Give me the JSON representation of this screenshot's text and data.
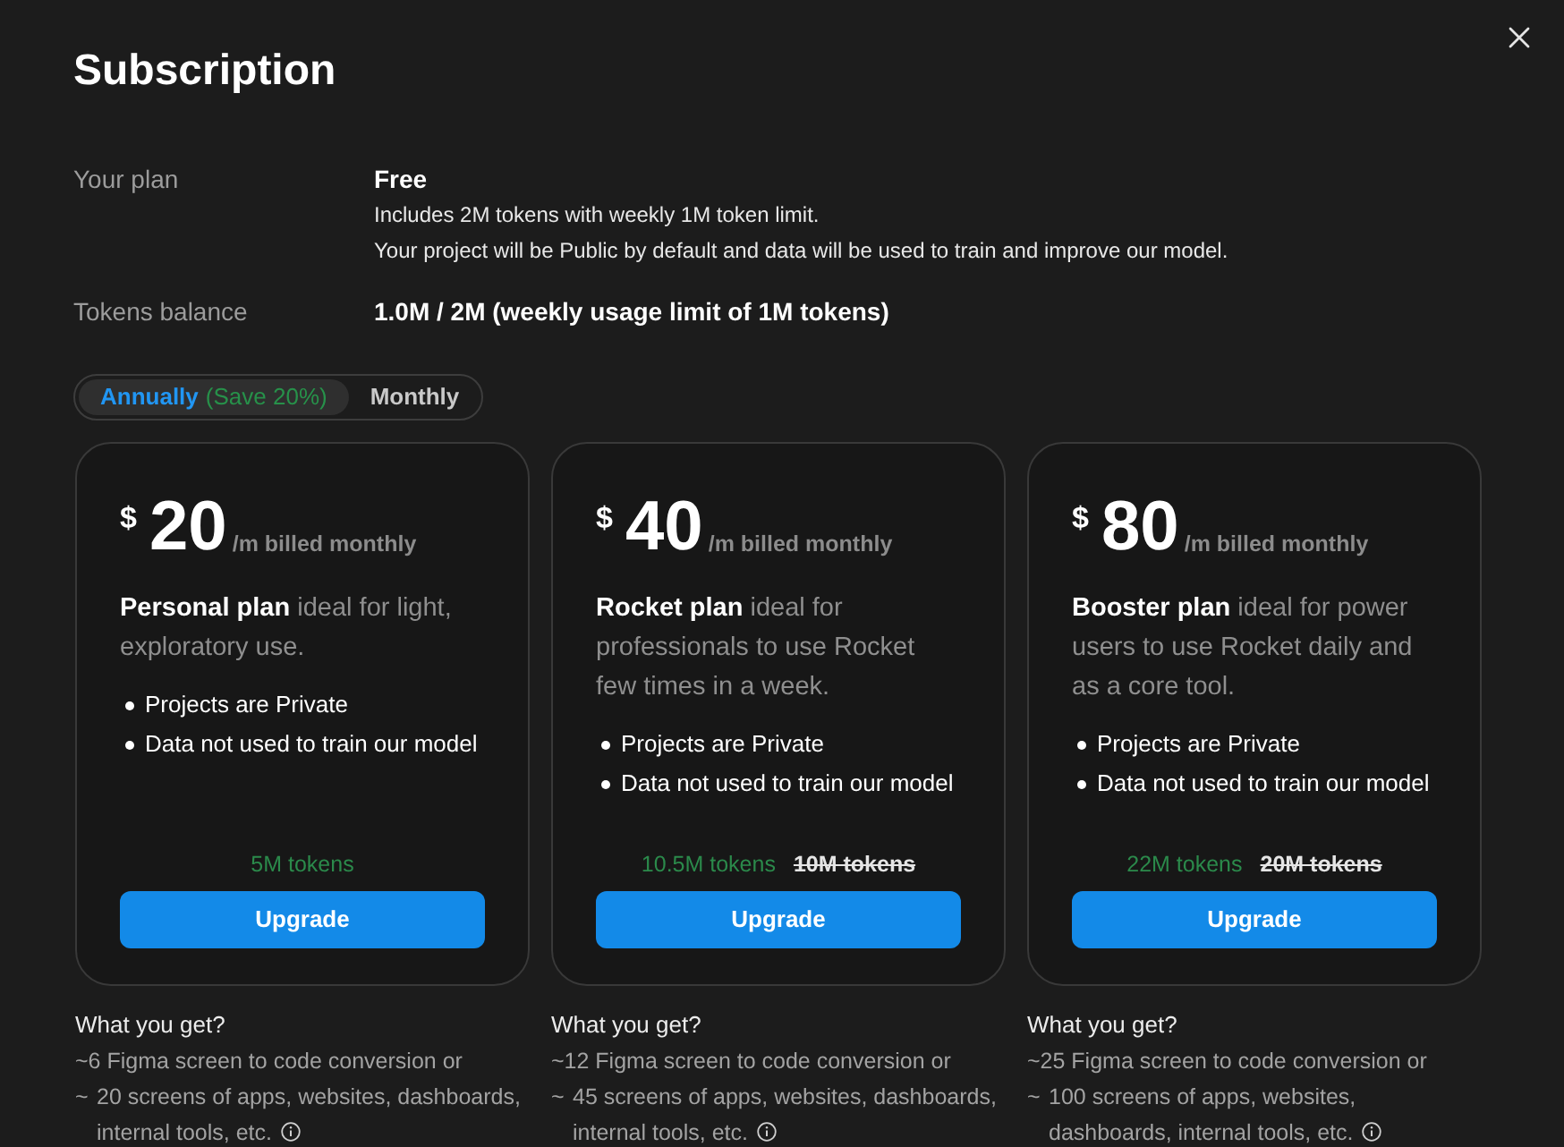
{
  "dialog": {
    "title": "Subscription"
  },
  "account": [
    {
      "label": "Your plan",
      "value": "Free",
      "details": [
        "Includes 2M tokens with weekly 1M token limit.",
        "Your project will be Public by default and data will be used to train and improve our model."
      ]
    },
    {
      "label": "Tokens balance",
      "value": "1.0M / 2M (weekly usage limit of 1M tokens)"
    }
  ],
  "billing_toggle": [
    {
      "label": "Annually",
      "note": "(Save 20%)",
      "selected": true
    },
    {
      "label": "Monthly",
      "selected": false
    }
  ],
  "plans": [
    {
      "currency": "$",
      "price": "20",
      "period": "/m billed monthly",
      "description": "**Personal plan** ideal for light, exploratory use.",
      "features": [
        "Projects are Private",
        "Data not used to train our model"
      ],
      "tokens": "5M tokens",
      "button": "Upgrade",
      "benefits_title": "What you get?",
      "benefits": [
        {
          "kind": "line",
          "text": "~6 Figma screen to code conversion or"
        },
        {
          "kind": "item",
          "marker": "~",
          "text": "20 screens of apps, websites, dashboards, internal tools, etc.",
          "info": true
        }
      ]
    },
    {
      "currency": "$",
      "price": "40",
      "period": "/m billed monthly",
      "description": "**Rocket plan** ideal for professionals to use Rocket few times in a week.",
      "features": [
        "Projects are Private",
        "Data not used to train our model"
      ],
      "tokens": "10.5M tokens",
      "previous_tokens": "10M tokens",
      "button": "Upgrade",
      "benefits_title": "What you get?",
      "benefits": [
        {
          "kind": "line",
          "text": "~12 Figma screen to code conversion or"
        },
        {
          "kind": "item",
          "marker": "~",
          "text": "45 screens of apps, websites, dashboards, internal tools, etc.",
          "info": true
        }
      ]
    },
    {
      "currency": "$",
      "price": "80",
      "period": "/m billed monthly",
      "description": "**Booster plan** ideal for power users to use Rocket daily and as a core tool.",
      "features": [
        "Projects are Private",
        "Data not used to train our model"
      ],
      "tokens": "22M tokens",
      "previous_tokens": "20M tokens",
      "button": "Upgrade",
      "benefits_title": "What you get?",
      "benefits": [
        {
          "kind": "line",
          "text": "~25 Figma screen to code conversion or"
        },
        {
          "kind": "item",
          "marker": "~",
          "text": "100 screens of apps, websites, dashboards, internal tools, etc.",
          "info": true
        }
      ]
    }
  ]
}
